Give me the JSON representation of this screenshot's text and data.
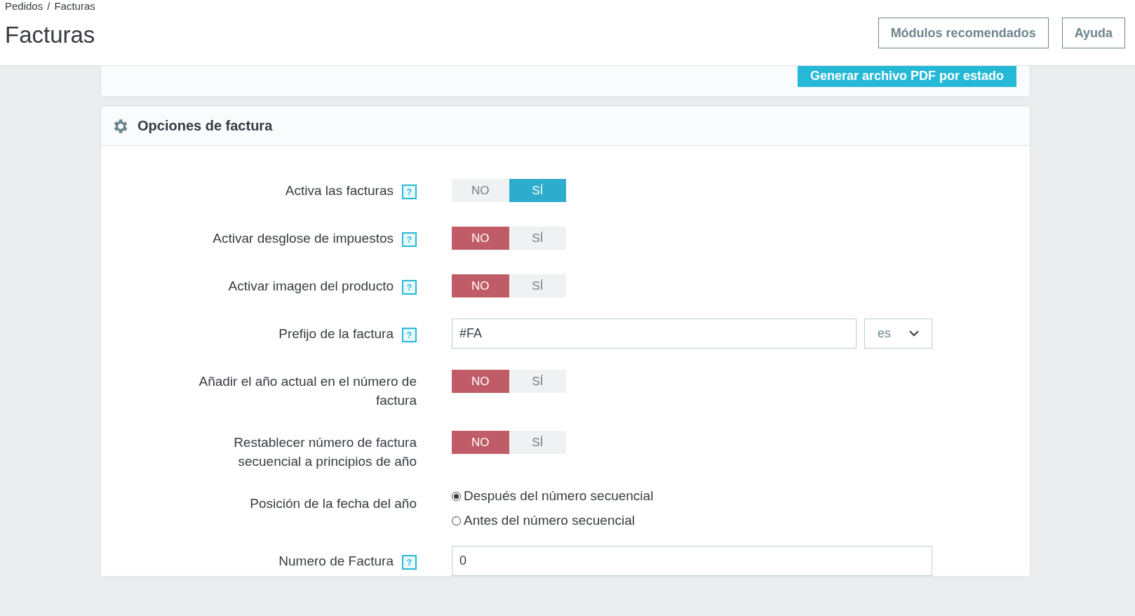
{
  "breadcrumb": [
    "Pedidos",
    "Facturas"
  ],
  "breadcrumb_separator": "/",
  "title": "Facturas",
  "header_buttons": [
    "Módulos recomendados",
    "Ayuda"
  ],
  "pdf_button": "Generar archivo PDF por estado",
  "panel": {
    "title": "Opciones de factura",
    "rows": [
      {
        "kind": "toggle",
        "label": "Activa las facturas",
        "help": "?",
        "off_label": "NO",
        "on_label": "SÍ",
        "on": true
      },
      {
        "kind": "toggle",
        "label": "Activar desglose de impuestos",
        "help": "?",
        "off_label": "NO",
        "on_label": "SÍ",
        "on": false
      },
      {
        "kind": "toggle",
        "label": "Activar imagen del producto",
        "help": "?",
        "off_label": "NO",
        "on_label": "SÍ",
        "on": false
      },
      {
        "kind": "input",
        "label": "Prefijo de la factura",
        "help": "?",
        "value": "#FA",
        "language": "es"
      },
      {
        "kind": "toggle",
        "label": "Añadir el año actual en el número de factura",
        "off_label": "NO",
        "on_label": "SÍ",
        "on": false
      },
      {
        "kind": "toggle",
        "label": "Restablecer número de factura secuencial a principios de año",
        "off_label": "NO",
        "on_label": "SÍ",
        "on": false
      },
      {
        "kind": "radio",
        "label": "Posición de la fecha del año",
        "options": [
          {
            "label": "Después del número secuencial",
            "selected": true
          },
          {
            "label": "Antes del número secuencial",
            "selected": false
          }
        ]
      },
      {
        "kind": "input",
        "label": "Numero de Factura",
        "help": "?",
        "value": "0"
      }
    ]
  }
}
